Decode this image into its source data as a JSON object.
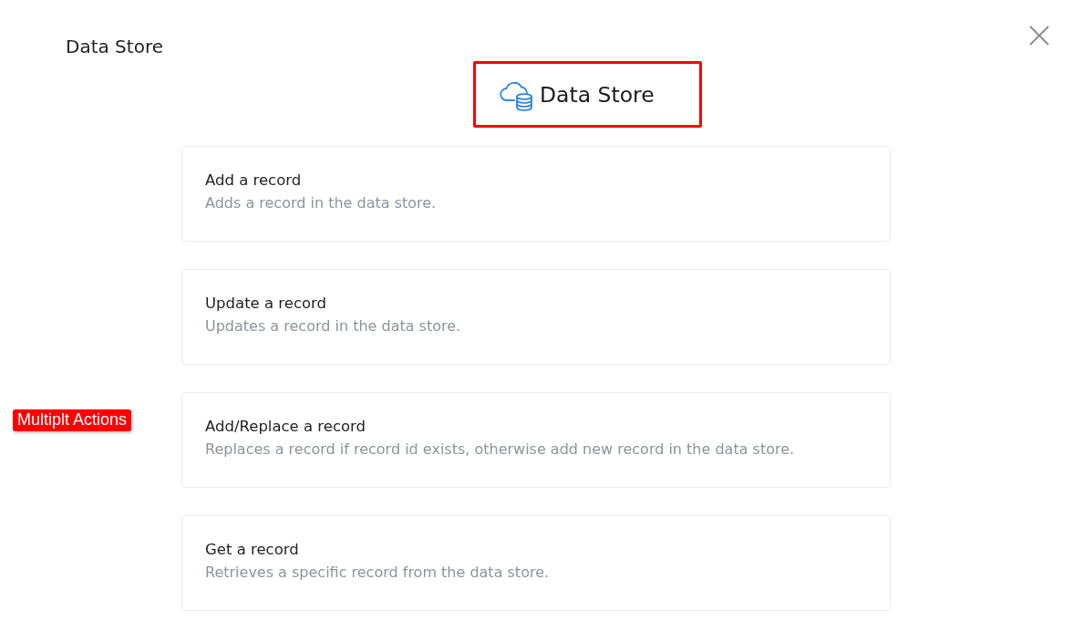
{
  "window": {
    "title": "Data Store"
  },
  "header": {
    "title": "Data Store",
    "highlighted": true
  },
  "actions": [
    {
      "title": "Add a record",
      "description": "Adds a record in the data store."
    },
    {
      "title": "Update a record",
      "description": "Updates a record in the data store."
    },
    {
      "title": "Add/Replace a record",
      "description": "Replaces a record if record id exists, otherwise add new record in the data store.",
      "callout": "Multiplt Actions"
    },
    {
      "title": "Get a record",
      "description": "Retrieves a specific record from the data store."
    }
  ]
}
